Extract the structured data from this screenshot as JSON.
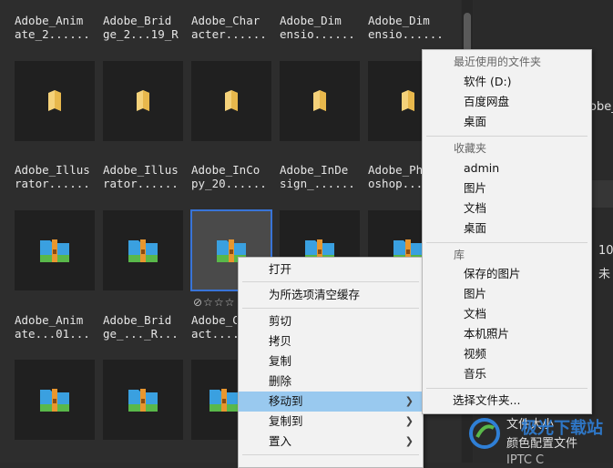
{
  "grid": {
    "row1_names": [
      [
        "Adobe_Anim",
        "ate_2......"
      ],
      [
        "Adobe_Brid",
        "ge_2...19_R"
      ],
      [
        "Adobe_Char",
        "acter......"
      ],
      [
        "Adobe_Dim",
        "ensio......"
      ],
      [
        "Adobe_Dim",
        "ensio......"
      ]
    ],
    "row2_names": [
      [
        "Adobe_Illus",
        "rator......"
      ],
      [
        "Adobe_Illus",
        "rator......"
      ],
      [
        "Adobe_InCo",
        "py_20......"
      ],
      [
        "Adobe_InDe",
        "sign_......"
      ],
      [
        "Adobe_Ph",
        "oshop......"
      ]
    ],
    "row3_names": [
      [
        "Adobe_Anim",
        "ate...01..."
      ],
      [
        "Adobe_Brid",
        "ge_..._R..."
      ],
      [
        "Adobe_C",
        "act...."
      ]
    ],
    "rating": "⊘☆☆☆"
  },
  "context_menu": {
    "items": [
      "打开",
      "为所选项清空缓存",
      "剪切",
      "拷贝",
      "复制",
      "删除",
      "移动到",
      "复制到",
      "置入"
    ],
    "highlighted": "移动到"
  },
  "submenu": {
    "recent_header": "最近使用的文件夹",
    "recent": [
      "软件 (D:)",
      "百度网盘",
      "桌面"
    ],
    "favorites_header": "收藏夹",
    "favorites": [
      "admin",
      "图片",
      "文档",
      "桌面"
    ],
    "library_header": "库",
    "library": [
      "保存的图片",
      "图片",
      "文档",
      "本机照片",
      "视频",
      "音乐"
    ],
    "choose_folder": "选择文件夹..."
  },
  "right_panel": {
    "fragment_1": "obe_",
    "fragment_2": "10",
    "fragment_3": "未",
    "line_file_size": "文件大小",
    "line_color_profile": "颜色配置文件",
    "line_iptc": "IPTC C"
  },
  "watermark": {
    "text": "极光下载站"
  },
  "colors": {
    "accent": "#3874d8",
    "menu_highlight": "#99c9ef",
    "folder_yellow": "#f5d27a",
    "zip_blue": "#3aa0e0",
    "zip_orange": "#e8962e",
    "zip_green": "#59b84a"
  }
}
